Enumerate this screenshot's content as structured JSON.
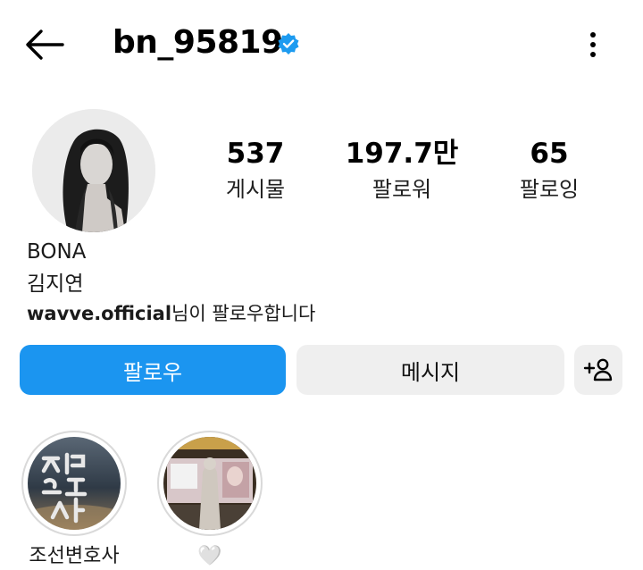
{
  "header": {
    "username": "bn_95819",
    "verified": true,
    "back_icon": "arrow-left-icon",
    "more_icon": "more-vertical-icon"
  },
  "profile": {
    "stats": [
      {
        "value": "537",
        "label": "게시물"
      },
      {
        "value": "197.7만",
        "label": "팔로워"
      },
      {
        "value": "65",
        "label": "팔로잉"
      }
    ],
    "full_name": "BONA",
    "bio": "김지연",
    "followed_by_user": "wavve.official",
    "followed_by_suffix": "님이 팔로우합니다"
  },
  "actions": {
    "follow_label": "팔로우",
    "message_label": "메시지",
    "add_icon": "add-person-icon"
  },
  "highlights": [
    {
      "caption": "조선변호사"
    },
    {
      "caption": "🤍"
    }
  ],
  "colors": {
    "accent": "#1b95f0",
    "secondary_button": "#efefef",
    "verified": "#1d9bf0"
  }
}
